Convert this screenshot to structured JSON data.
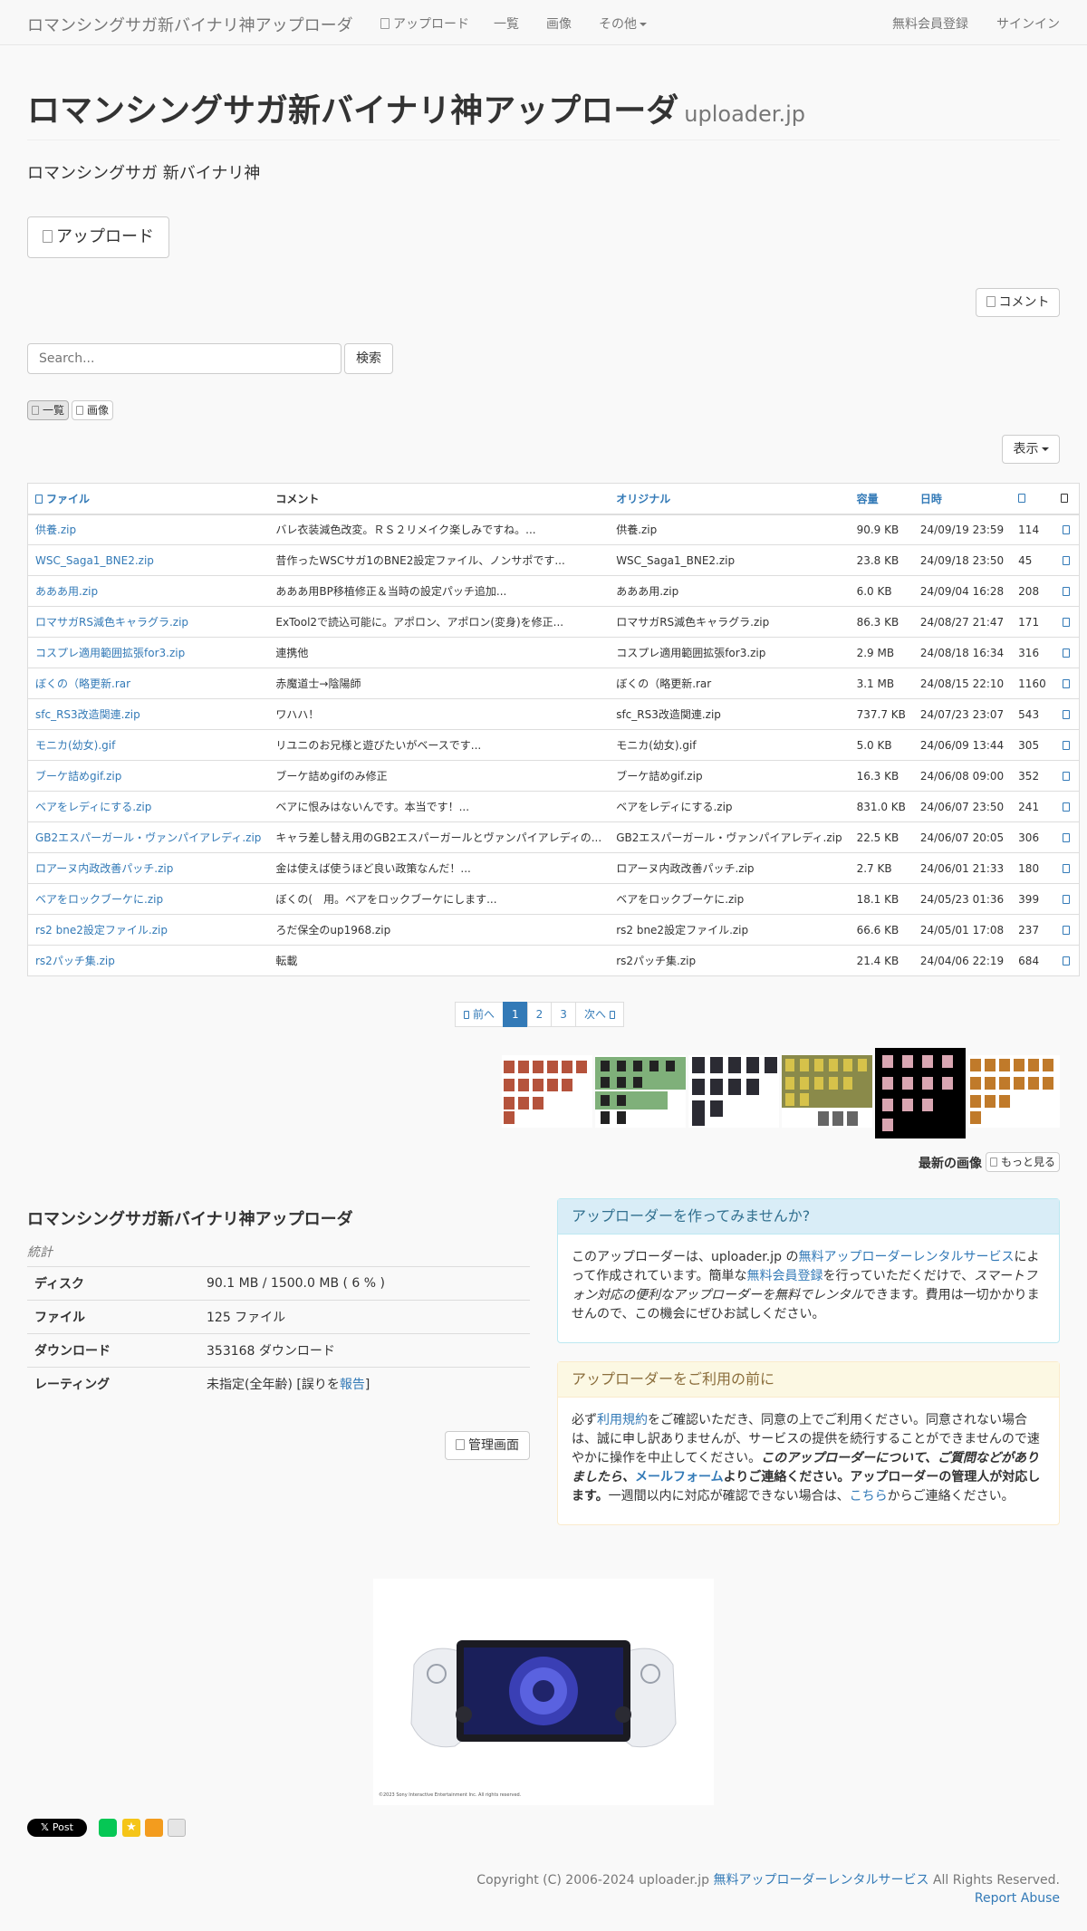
{
  "navbar": {
    "brand": "ロマンシングサガ新バイナリ神アップローダ",
    "upload": "アップロード",
    "list": "一覧",
    "images": "画像",
    "other": "その他",
    "register": "無料会員登録",
    "signin": "サインイン"
  },
  "header": {
    "title": "ロマンシングサガ新バイナリ神アップローダ",
    "domain": "uploader.jp",
    "lead": "ロマンシングサガ 新バイナリ神"
  },
  "actions": {
    "upload_button": "アップロード",
    "comment_button": "コメント",
    "search_placeholder": "Search...",
    "search_button": "検索",
    "view_list": "一覧",
    "view_images": "画像",
    "display_button": "表示"
  },
  "table": {
    "headers": [
      "ファイル",
      "コメント",
      "オリジナル",
      "容量",
      "日時",
      "",
      ""
    ],
    "rows": [
      {
        "file": "供養.zip",
        "comment": "バレ衣装減色改変。ＲＳ２リメイク楽しみですね。...",
        "original": "供養.zip",
        "size": "90.9 KB",
        "date": "24/09/19 23:59",
        "count": "114"
      },
      {
        "file": "WSC_Saga1_BNE2.zip",
        "comment": "昔作ったWSCサガ1のBNE2設定ファイル、ノンサポです...",
        "original": "WSC_Saga1_BNE2.zip",
        "size": "23.8 KB",
        "date": "24/09/18 23:50",
        "count": "45"
      },
      {
        "file": "あああ用.zip",
        "comment": "あああ用BP移植修正＆当時の設定パッチ追加...",
        "original": "あああ用.zip",
        "size": "6.0 KB",
        "date": "24/09/04 16:28",
        "count": "208"
      },
      {
        "file": "ロマサガRS減色キャラグラ.zip",
        "comment": "ExTool2で読込可能に。アポロン、アポロン(変身)を修正...",
        "original": "ロマサガRS減色キャラグラ.zip",
        "size": "86.3 KB",
        "date": "24/08/27 21:47",
        "count": "171"
      },
      {
        "file": "コスプレ適用範囲拡張for3.zip",
        "comment": "連携他",
        "original": "コスプレ適用範囲拡張for3.zip",
        "size": "2.9 MB",
        "date": "24/08/18 16:34",
        "count": "316"
      },
      {
        "file": "ぼくの（略更新.rar",
        "comment": "赤魔道士→陰陽師",
        "original": "ぼくの（略更新.rar",
        "size": "3.1 MB",
        "date": "24/08/15 22:10",
        "count": "1160"
      },
      {
        "file": "sfc_RS3改造関連.zip",
        "comment": "ワハハ！",
        "original": "sfc_RS3改造関連.zip",
        "size": "737.7 KB",
        "date": "24/07/23 23:07",
        "count": "543"
      },
      {
        "file": "モニカ(幼女).gif",
        "comment": "リユニのお兄様と遊びたいがベースです...",
        "original": "モニカ(幼女).gif",
        "size": "5.0 KB",
        "date": "24/06/09 13:44",
        "count": "305"
      },
      {
        "file": "ブーケ詰めgif.zip",
        "comment": "ブーケ詰めgifのみ修正",
        "original": "ブーケ詰めgif.zip",
        "size": "16.3 KB",
        "date": "24/06/08 09:00",
        "count": "352"
      },
      {
        "file": "ベアをレディにする.zip",
        "comment": "ベアに恨みはないんです。本当です！...",
        "original": "ベアをレディにする.zip",
        "size": "831.0 KB",
        "date": "24/06/07 23:50",
        "count": "241"
      },
      {
        "file": "GB2エスパーガール・ヴァンパイアレディ.zip",
        "comment": "キャラ差し替え用のGB2エスパーガールとヴァンパイアレディの...",
        "original": "GB2エスパーガール・ヴァンパイアレディ.zip",
        "size": "22.5 KB",
        "date": "24/06/07 20:05",
        "count": "306"
      },
      {
        "file": "ロアーヌ内政改善パッチ.zip",
        "comment": "金は使えば使うほど良い政策なんだ！...",
        "original": "ロアーヌ内政改善パッチ.zip",
        "size": "2.7 KB",
        "date": "24/06/01 21:33",
        "count": "180"
      },
      {
        "file": "ベアをロックブーケに.zip",
        "comment": "ぼくの(　用。ベアをロックブーケにします...",
        "original": "ベアをロックブーケに.zip",
        "size": "18.1 KB",
        "date": "24/05/23 01:36",
        "count": "399"
      },
      {
        "file": "rs2 bne2設定ファイル.zip",
        "comment": "ろだ保全のup1968.zip",
        "original": "rs2 bne2設定ファイル.zip",
        "size": "66.6 KB",
        "date": "24/05/01 17:08",
        "count": "237"
      },
      {
        "file": "rs2パッチ集.zip",
        "comment": "転載",
        "original": "rs2パッチ集.zip",
        "size": "21.4 KB",
        "date": "24/04/06 22:19",
        "count": "684"
      }
    ]
  },
  "pagination": {
    "prev": "前へ",
    "pages": [
      "1",
      "2",
      "3"
    ],
    "next": "次へ"
  },
  "gallery": {
    "latest_label": "最新の画像",
    "more_button": "もっと見る"
  },
  "info": {
    "title": "ロマンシングサガ新バイナリ神アップローダ",
    "stats_caption": "統計",
    "rows": [
      {
        "key": "ディスク",
        "value": "90.1 MB / 1500.0 MB ( 6 % )"
      },
      {
        "key": "ファイル",
        "value": "125 ファイル"
      },
      {
        "key": "ダウンロード",
        "value": "353168 ダウンロード"
      }
    ],
    "rating_key": "レーティング",
    "rating_value": "未指定(全年齢) [誤りを",
    "rating_link": "報告",
    "rating_end": "]",
    "admin_button": "管理画面"
  },
  "panel_info": {
    "title": "アップローダーを作ってみませんか?",
    "t1": "このアップローダーは、uploader.jp の",
    "l1": "無料アップローダーレンタルサービス",
    "t2": "によって作成されています。簡単な",
    "l2": "無料会員登録",
    "t3": "を行っていただくだけで、",
    "em1": "スマートフォン対応の便利なアップローダーを無料でレンタル",
    "t4": "できます。費用は一切かかりませんので、この機会にぜひお試しください。"
  },
  "panel_warn": {
    "title": "アップローダーをご利用の前に",
    "t1": "必ず",
    "l1": "利用規約",
    "t2": "をご確認いただき、同意の上でご利用ください。同意されない場合は、誠に申し訳ありませんが、サービスの提供を続行することができませんので速やかに操作を中止してください。",
    "b1": "このアップローダーについて、ご質問などがありましたら、",
    "l2": "メールフォーム",
    "b2": "よりご連絡ください。アップローダーの管理人が対応します。",
    "t3": "一週間以内に対応が確認できない場合は、",
    "l3": "こちら",
    "t4": "からご連絡ください。"
  },
  "ad": {
    "fineprint": "©2023 Sony Interactive Entertainment Inc. All rights reserved."
  },
  "social": {
    "post_button": "Post"
  },
  "footer": {
    "copyright": "Copyright (C) 2006-2024 uploader.jp ",
    "service_link": "無料アップローダーレンタルサービス",
    "rights": " All Rights Reserved.",
    "report": "Report Abuse"
  },
  "colors": {
    "link": "#337ab7",
    "info_panel": "#d9edf7",
    "warn_panel": "#fcf8e3",
    "active_page": "#337ab7"
  }
}
